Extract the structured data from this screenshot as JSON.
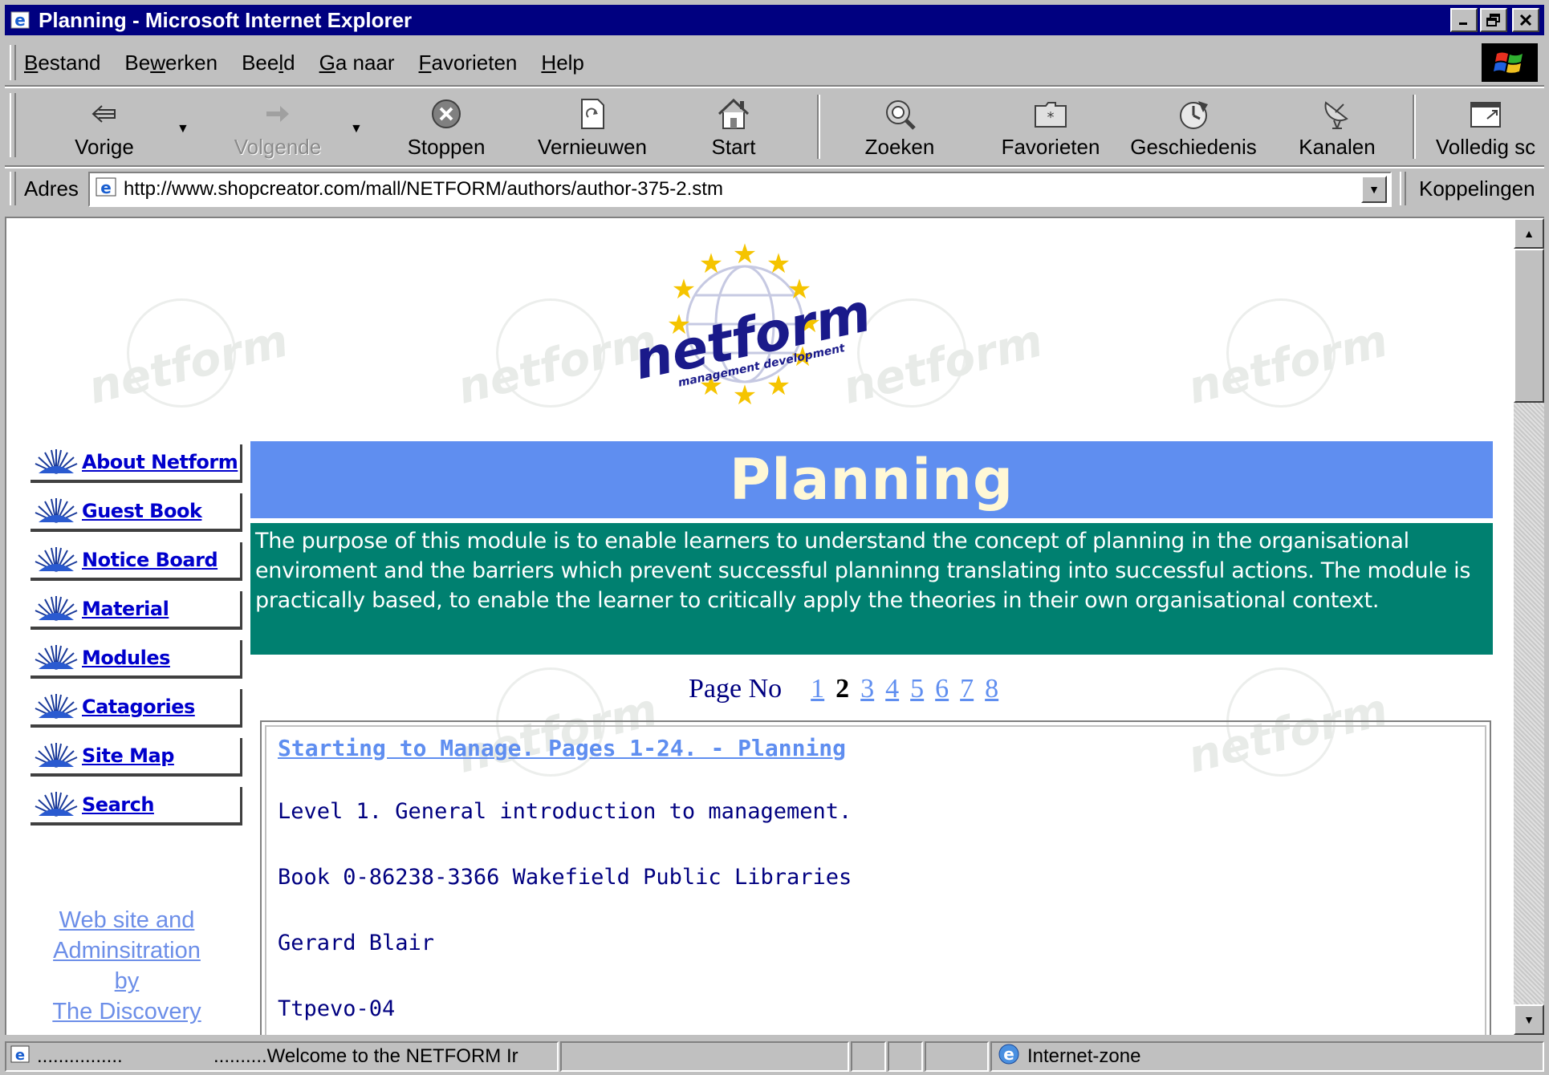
{
  "window": {
    "title": "Planning - Microsoft Internet Explorer",
    "controls": [
      "minimize",
      "maximize",
      "close"
    ]
  },
  "menu": {
    "items": [
      {
        "label": "Bestand",
        "accel": "B"
      },
      {
        "label": "Bewerken",
        "accel": "w"
      },
      {
        "label": "Beeld",
        "accel": "l"
      },
      {
        "label": "Ga naar",
        "accel": "G"
      },
      {
        "label": "Favorieten",
        "accel": "F"
      },
      {
        "label": "Help",
        "accel": "H"
      }
    ]
  },
  "toolbar": {
    "back": "Vorige",
    "forward": "Volgende",
    "stop": "Stoppen",
    "refresh": "Vernieuwen",
    "home": "Start",
    "search": "Zoeken",
    "favorites": "Favorieten",
    "history": "Geschiedenis",
    "channels": "Kanalen",
    "fullscreen": "Volledig sc"
  },
  "address": {
    "label": "Adres",
    "url": "http://www.shopcreator.com/mall/NETFORM/authors/author-375-2.stm",
    "links_label": "Koppelingen"
  },
  "logo": {
    "main": "netform",
    "sub": "management development"
  },
  "watermark": "netform",
  "nav": [
    "About Netform",
    "Guest Book",
    "Notice Board",
    "Material",
    "Modules",
    "Catagories",
    "Site Map",
    "Search"
  ],
  "side_links": [
    "Web site and",
    "Adminsitration",
    "by",
    "The Discovery"
  ],
  "banner": {
    "title": "Planning"
  },
  "description": "The purpose of this module is to enable learners to understand the concept of planning in the organisational enviroment and the barriers which prevent successful planninng translating into successful actions. The module is practically based, to enable the learner to critically apply the theories in their own organisational context.",
  "pagination": {
    "label": "Page No",
    "pages": [
      "1",
      "2",
      "3",
      "4",
      "5",
      "6",
      "7",
      "8"
    ],
    "current": "2"
  },
  "entry": {
    "title": "Starting to Manage. Pages 1-24. - Planning",
    "lines": [
      "Level 1. General introduction to management.",
      "Book 0-86238-3366 Wakefield Public Libraries",
      "Gerard Blair",
      "Ttpevo-04"
    ]
  },
  "status": {
    "left": "................",
    "message": "..........Welcome to the NETFORM Ir",
    "zone": "Internet-zone"
  },
  "colors": {
    "titlebar": "#000080",
    "banner": "#5f8ef0",
    "description_bg": "#008070",
    "link": "#5f8ef0",
    "nav_text": "#0000cc"
  }
}
